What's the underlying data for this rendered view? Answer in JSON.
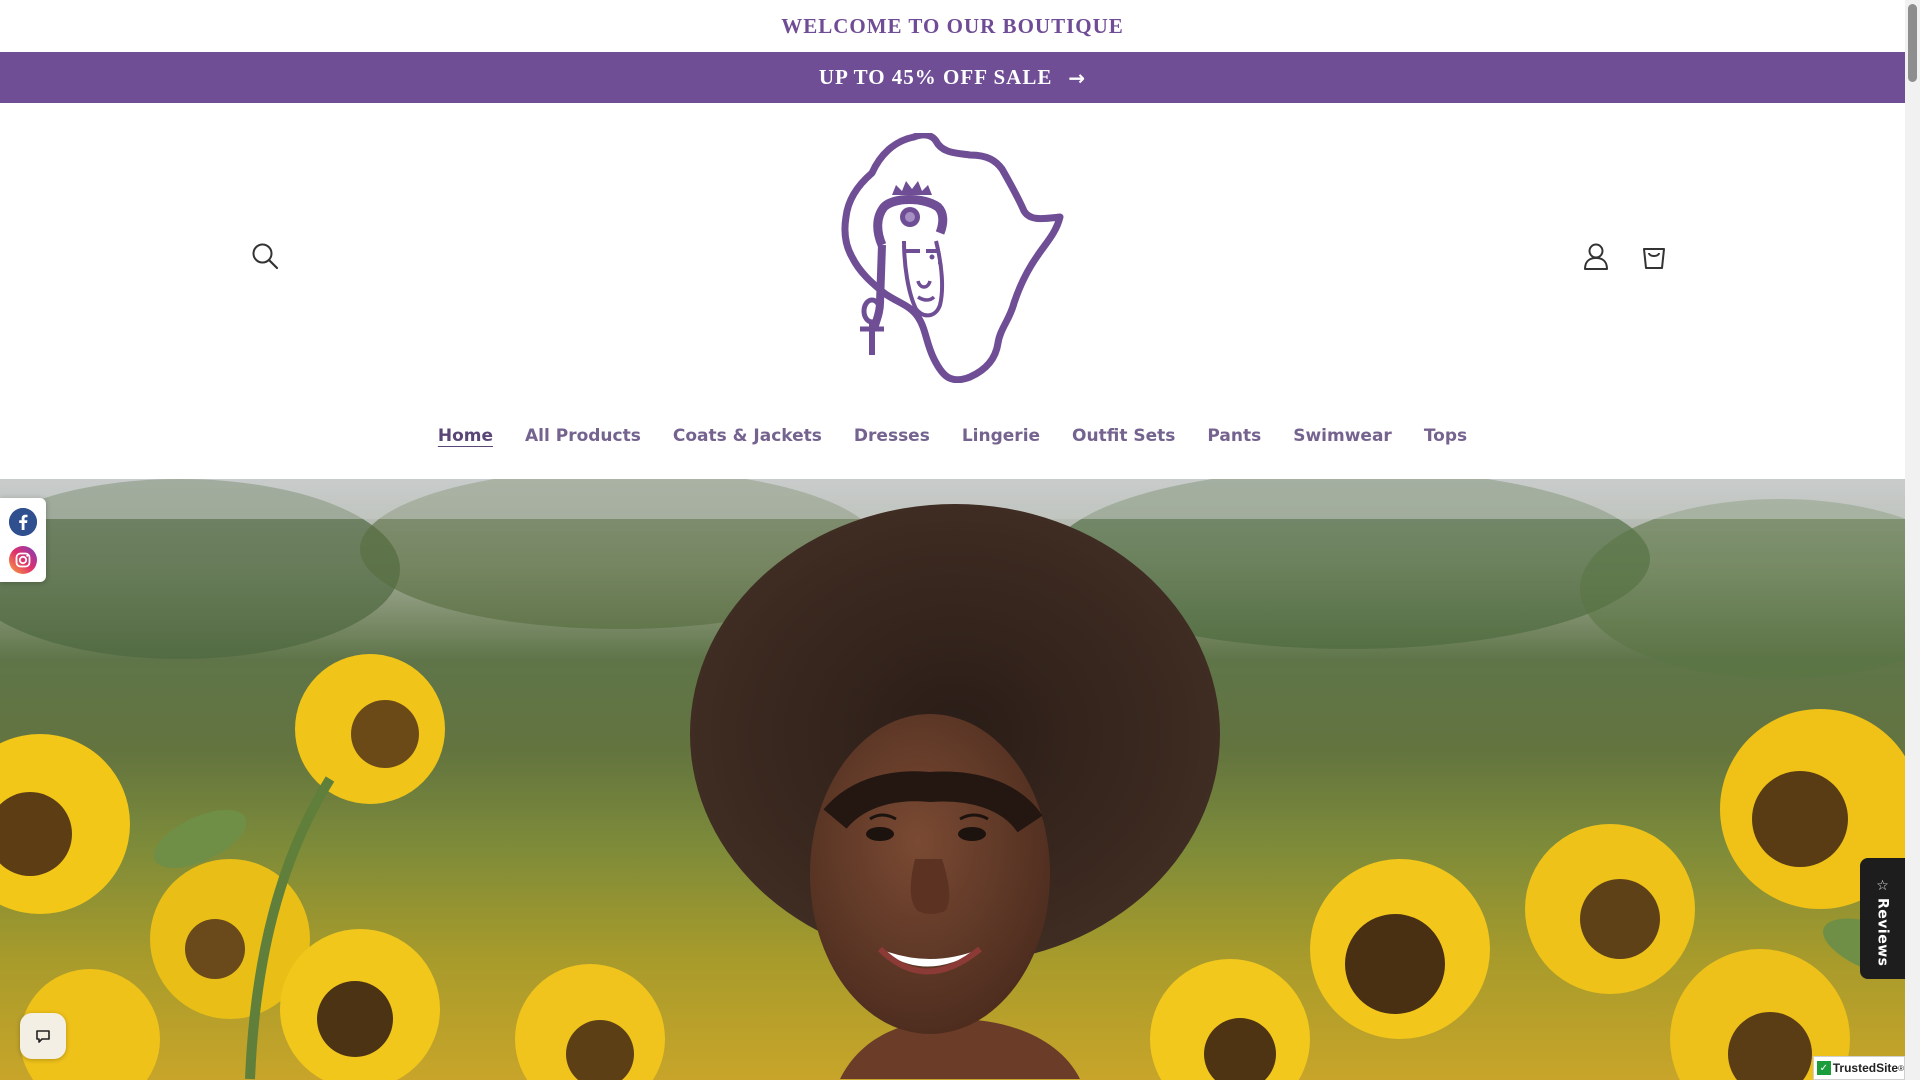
{
  "announcement": {
    "welcome_text": "WELCOME TO OUR BOUTIQUE",
    "sale_text": "UP TO 45% OFF SALE",
    "sale_arrow": "→"
  },
  "header": {
    "search_icon": "search-icon",
    "account_icon": "account-icon",
    "cart_icon": "cart-icon",
    "logo": "africa-map-queen-logo"
  },
  "nav": {
    "items": [
      {
        "label": "Home",
        "active": true
      },
      {
        "label": "All Products"
      },
      {
        "label": "Coats & Jackets"
      },
      {
        "label": "Dresses"
      },
      {
        "label": "Lingerie"
      },
      {
        "label": "Outfit Sets"
      },
      {
        "label": "Pants"
      },
      {
        "label": "Swimwear"
      },
      {
        "label": "Tops"
      }
    ]
  },
  "social": {
    "facebook_icon": "facebook-icon",
    "instagram_icon": "instagram-icon"
  },
  "reviews_tab": {
    "label": "Reviews",
    "icon": "star-icon"
  },
  "chat": {
    "icon": "chat-icon"
  },
  "trusted_badge": {
    "check": "✓",
    "brand": "TrustedSite",
    "sup": "®",
    "caret": "▾"
  },
  "colors": {
    "brand_purple": "#6f4e95",
    "nav_text": "#75638f",
    "reviews_bg": "#1d1d1d"
  }
}
